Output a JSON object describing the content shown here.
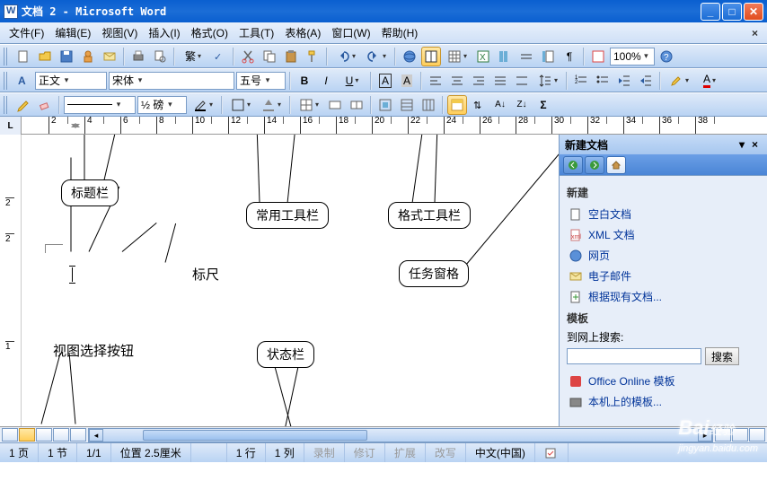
{
  "title": "文档 2 - Microsoft Word",
  "menu": {
    "items": [
      "文件(F)",
      "编辑(E)",
      "视图(V)",
      "插入(I)",
      "格式(O)",
      "工具(T)",
      "表格(A)",
      "窗口(W)",
      "帮助(H)"
    ]
  },
  "zoom": "100%",
  "formatting": {
    "style": "正文",
    "font": "宋体",
    "size": "五号"
  },
  "outline_level": "½ 磅",
  "ruler_ticks": [
    "2",
    "4",
    "6",
    "8",
    "10",
    "12",
    "14",
    "16",
    "18",
    "20",
    "22",
    "24",
    "26",
    "28",
    "30",
    "32",
    "34",
    "36",
    "38"
  ],
  "vruler_labels": [
    "2",
    "2",
    "1"
  ],
  "annotations": {
    "titlebar": "标题栏",
    "std_toolbar": "常用工具栏",
    "fmt_toolbar": "格式工具栏",
    "ruler": "标尺",
    "taskpane": "任务窗格",
    "viewbtns": "视图选择按钮",
    "statusbar": "状态栏"
  },
  "taskpane": {
    "title": "新建文档",
    "sect_new": "新建",
    "links": {
      "blank": "空白文档",
      "xml": "XML 文档",
      "web": "网页",
      "email": "电子邮件",
      "existing": "根据现有文档..."
    },
    "sect_tpl": "模板",
    "search_label": "到网上搜索:",
    "search_btn": "搜索",
    "office_online": "Office Online 模板",
    "local_tpl": "本机上的模板..."
  },
  "status": {
    "page": "1 页",
    "sec": "1 节",
    "pages": "1/1",
    "pos": "位置 2.5厘米",
    "line": "1 行",
    "col": "1 列",
    "rec": "录制",
    "trk": "修订",
    "ext": "扩展",
    "ovr": "改写",
    "lang": "中文(中国)"
  },
  "watermark": {
    "brand": "Bai",
    "brand2": "经验",
    "url": "jingyan.baidu.com"
  }
}
